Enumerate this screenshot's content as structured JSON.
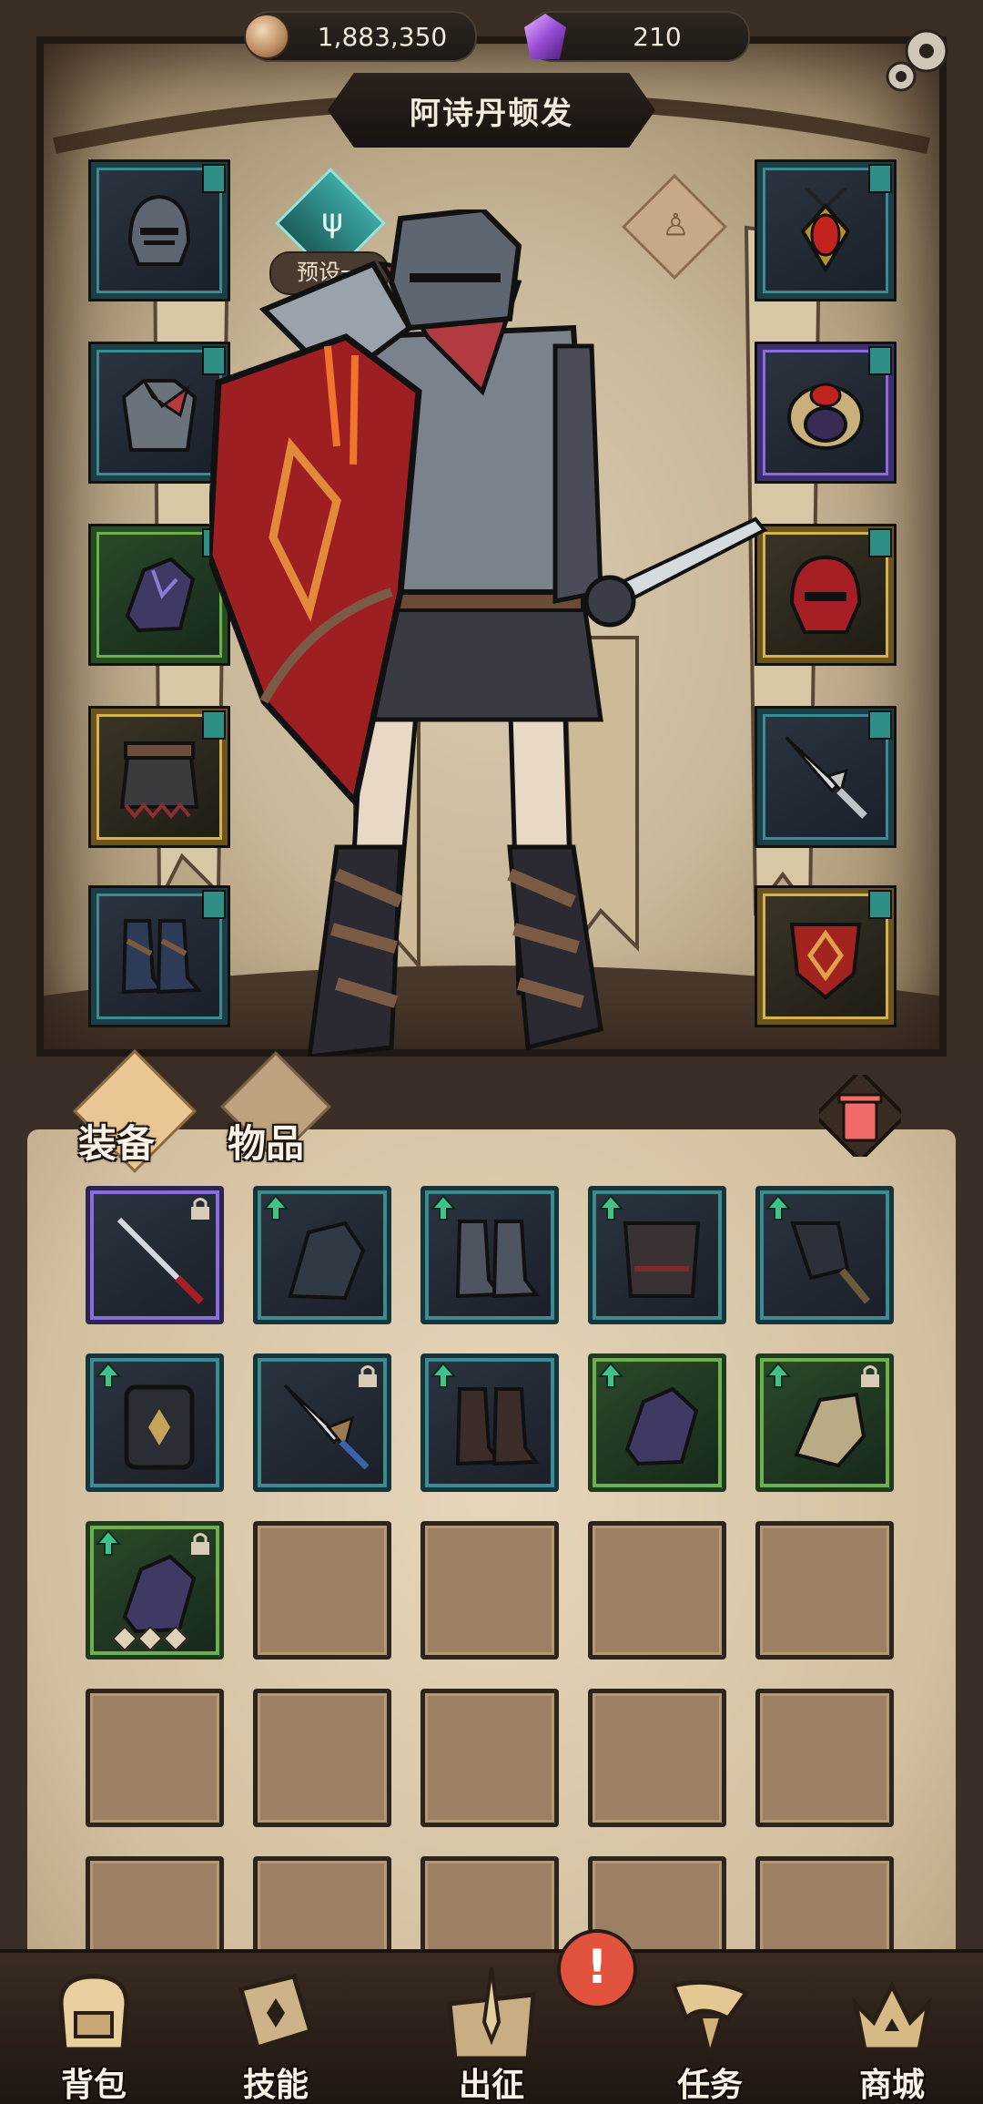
{
  "resources": {
    "gold": "1,883,350",
    "gems": "210"
  },
  "character_name": "阿诗丹顿发",
  "preset_label": "预设一",
  "tabs": {
    "equipment": "装备",
    "items": "物品"
  },
  "nav": {
    "backpack": "背包",
    "skills": "技能",
    "expedition": "出征",
    "tasks": "任务",
    "shop": "商城"
  },
  "alert_mark": "!",
  "colors": {
    "rarity_blue": "#3d8a90",
    "rarity_purple": "#8a6be0",
    "rarity_green": "#6fb04e",
    "rarity_gold": "#d6b24d",
    "upgrade_arrow": "#3fc38a",
    "alert": "#e2533d"
  }
}
